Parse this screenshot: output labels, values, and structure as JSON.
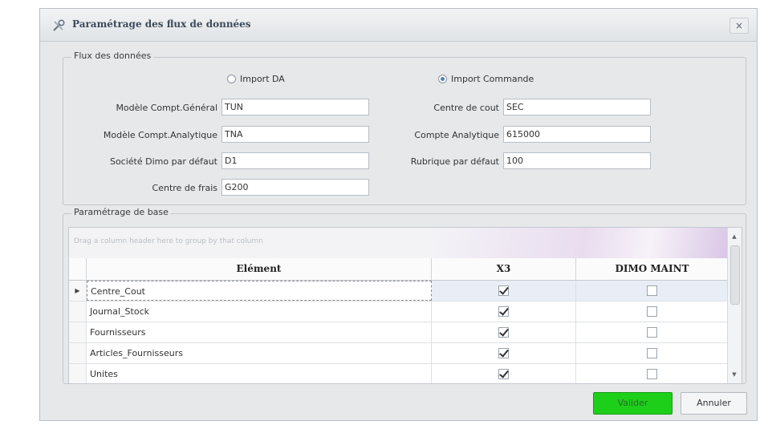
{
  "dialog": {
    "title": "Paramétrage des flux de données",
    "close_label": "×"
  },
  "flux": {
    "legend": "Flux des données",
    "radio_import_da": "Import DA",
    "radio_import_commande": "Import Commande",
    "selected_radio": "Import Commande",
    "fields_left": [
      {
        "label": "Modèle Compt.Général",
        "value": "TUN"
      },
      {
        "label": "Modèle Compt.Analytique",
        "value": "TNA"
      },
      {
        "label": "Société Dimo par défaut",
        "value": "D1"
      },
      {
        "label": "Centre de frais",
        "value": "G200"
      }
    ],
    "fields_right": [
      {
        "label": "Centre de cout",
        "value": "SEC"
      },
      {
        "label": "Compte Analytique",
        "value": "615000"
      },
      {
        "label": "Rubrique par défaut",
        "value": "100"
      }
    ]
  },
  "base": {
    "legend": "Paramétrage de base",
    "group_hint": "Drag a column header here to group by that column",
    "columns": [
      "Elément",
      "X3",
      "DIMO MAINT"
    ],
    "row_indicator": "▶",
    "rows": [
      {
        "element": "Centre_Cout",
        "x3": true,
        "dimo": false,
        "selected": true
      },
      {
        "element": "Journal_Stock",
        "x3": true,
        "dimo": false,
        "selected": false
      },
      {
        "element": "Fournisseurs",
        "x3": true,
        "dimo": false,
        "selected": false
      },
      {
        "element": "Articles_Fournisseurs",
        "x3": true,
        "dimo": false,
        "selected": false
      },
      {
        "element": "Unites",
        "x3": true,
        "dimo": false,
        "selected": false
      }
    ]
  },
  "buttons": {
    "validate": "Valider",
    "cancel": "Annuler"
  },
  "colors": {
    "validate_bg": "#1ecf1a",
    "dialog_bg": "#e6e8ea",
    "selected_row": "#e9eef6"
  }
}
